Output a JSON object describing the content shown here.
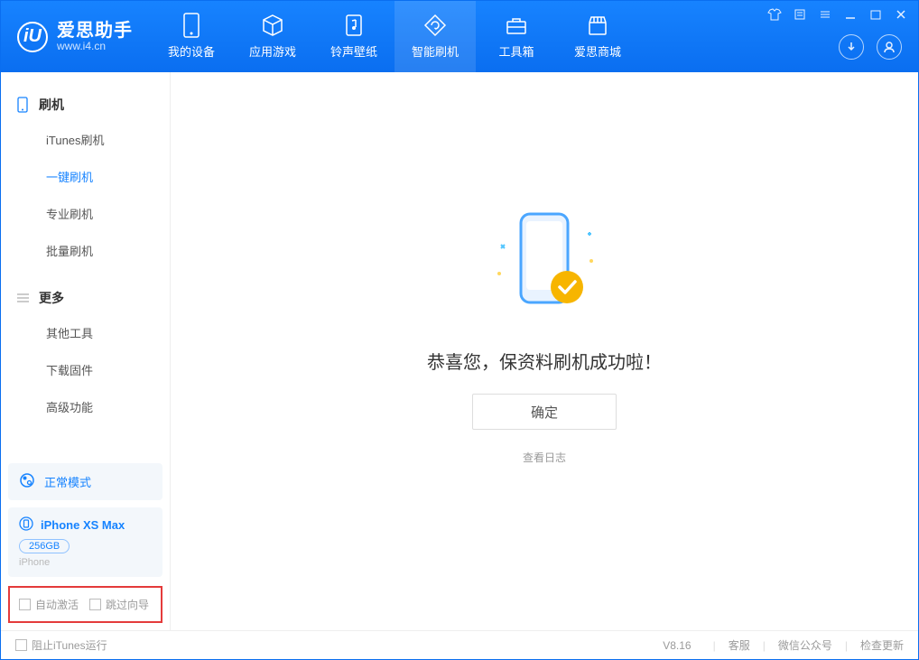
{
  "app": {
    "title": "爱思助手",
    "url": "www.i4.cn"
  },
  "nav": {
    "items": [
      {
        "label": "我的设备",
        "icon": "device-icon"
      },
      {
        "label": "应用游戏",
        "icon": "cube-icon"
      },
      {
        "label": "铃声壁纸",
        "icon": "music-icon"
      },
      {
        "label": "智能刷机",
        "icon": "refresh-icon",
        "active": true
      },
      {
        "label": "工具箱",
        "icon": "toolbox-icon"
      },
      {
        "label": "爱思商城",
        "icon": "store-icon"
      }
    ]
  },
  "sidebar": {
    "sections": [
      {
        "title": "刷机",
        "icon": "phone-icon",
        "items": [
          {
            "label": "iTunes刷机"
          },
          {
            "label": "一键刷机",
            "active": true
          },
          {
            "label": "专业刷机"
          },
          {
            "label": "批量刷机"
          }
        ]
      },
      {
        "title": "更多",
        "icon": "menu-icon",
        "items": [
          {
            "label": "其他工具"
          },
          {
            "label": "下载固件"
          },
          {
            "label": "高级功能"
          }
        ]
      }
    ],
    "mode_card": {
      "label": "正常模式"
    },
    "device": {
      "name": "iPhone XS Max",
      "storage": "256GB",
      "type": "iPhone"
    },
    "options": {
      "auto_activate": "自动激活",
      "skip_guide": "跳过向导"
    }
  },
  "main": {
    "success_message": "恭喜您，保资料刷机成功啦！",
    "ok_button": "确定",
    "view_log": "查看日志"
  },
  "footer": {
    "block_itunes": "阻止iTunes运行",
    "version": "V8.16",
    "links": {
      "service": "客服",
      "wechat": "微信公众号",
      "update": "检查更新"
    }
  }
}
